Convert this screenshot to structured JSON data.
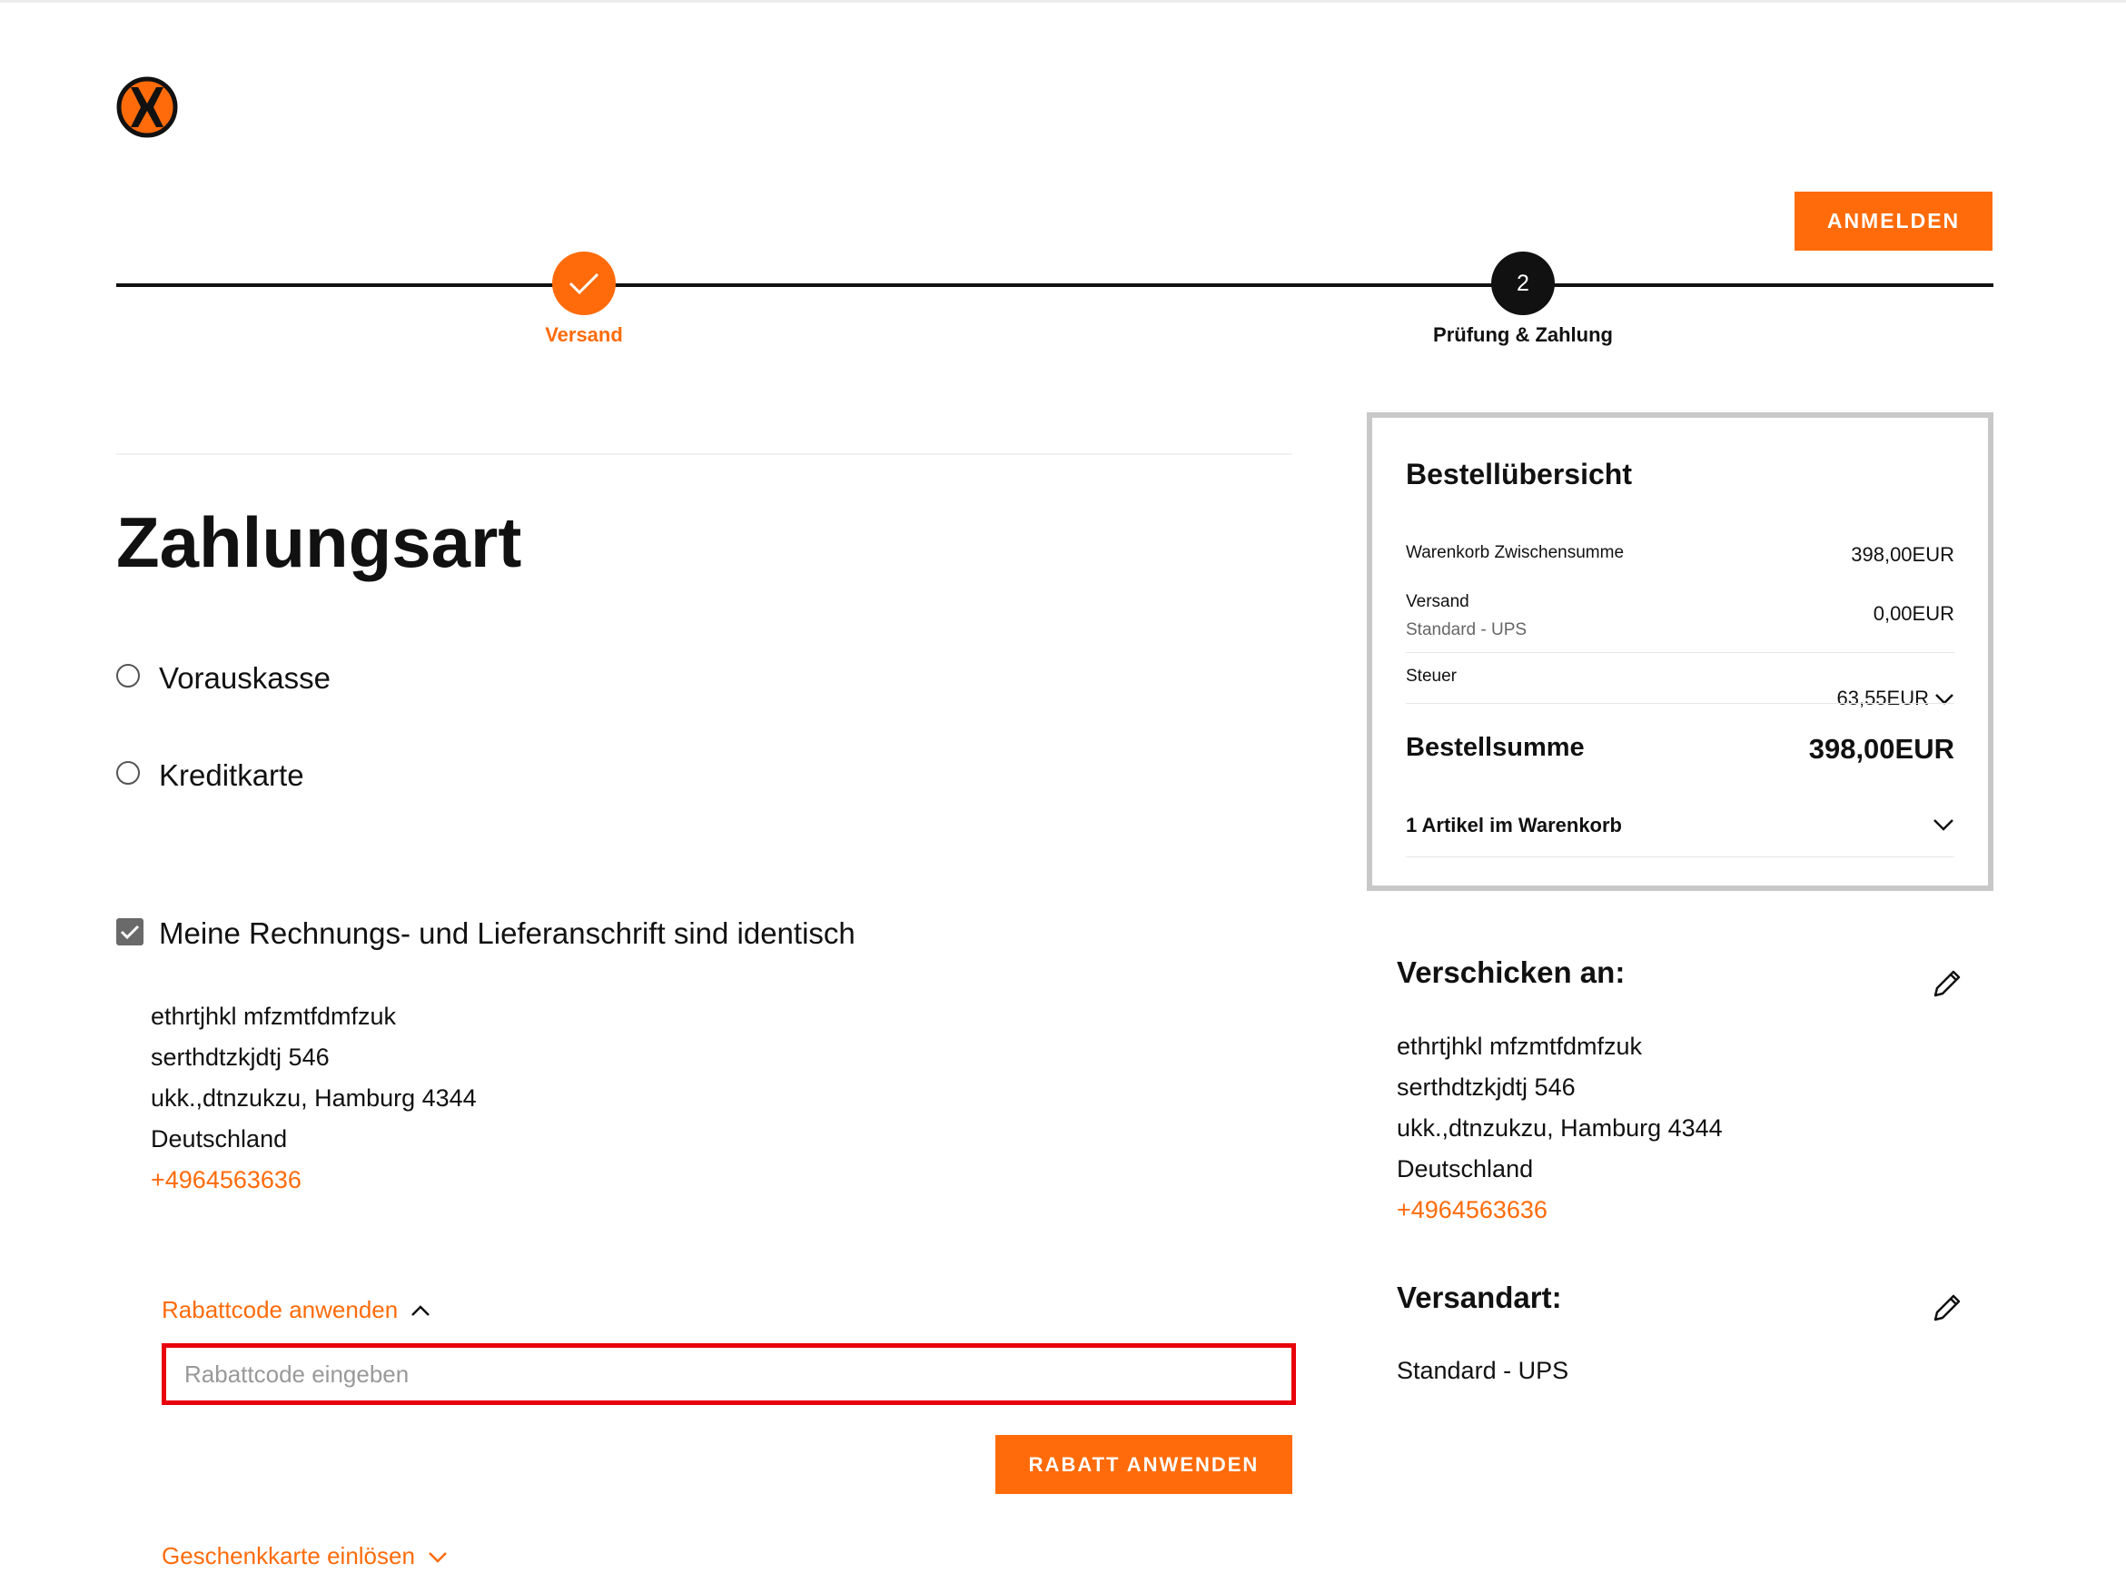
{
  "colors": {
    "accent": "#ff6b0a",
    "error_border": "#e8000b",
    "dark": "#111111"
  },
  "header": {
    "logo_icon": "brand-logo-icon",
    "signin_label": "ANMELDEN"
  },
  "steps": [
    {
      "label": "Versand",
      "state": "completed",
      "icon": "check-icon"
    },
    {
      "number": "2",
      "label": "Prüfung & Zahlung",
      "state": "current"
    }
  ],
  "payment": {
    "title": "Zahlungsart",
    "options": [
      {
        "label": "Vorauskasse",
        "selected": false
      },
      {
        "label": "Kreditkarte",
        "selected": false
      }
    ]
  },
  "billing": {
    "same_address_label": "Meine Rechnungs- und Lieferanschrift sind identisch",
    "same_address_checked": true,
    "address": {
      "name": "ethrtjhkl mfzmtfdmfzuk",
      "street": "serthdtzkjdtj 546",
      "city": "ukk.,dtnzukzu, Hamburg 4344",
      "country": "Deutschland",
      "phone": "+4964563636"
    }
  },
  "discount": {
    "toggle_label": "Rabattcode anwenden",
    "input_placeholder": "Rabattcode eingeben",
    "input_value": "",
    "apply_label": "RABATT ANWENDEN",
    "giftcard_label": "Geschenkkarte einlösen"
  },
  "summary": {
    "title": "Bestellübersicht",
    "subtotal_label": "Warenkorb Zwischensumme",
    "subtotal_value": "398,00EUR",
    "shipping_label": "Versand",
    "shipping_method": "Standard - UPS",
    "shipping_value": "0,00EUR",
    "tax_label": "Steuer",
    "tax_value": "63,55EUR",
    "total_label": "Bestellsumme",
    "total_value": "398,00EUR",
    "items_label": "1 Artikel im Warenkorb"
  },
  "ship_to": {
    "title": "Verschicken an:",
    "name": "ethrtjhkl mfzmtfdmfzuk",
    "street": "serthdtzkjdtj 546",
    "city": "ukk.,dtnzukzu, Hamburg 4344",
    "country": "Deutschland",
    "phone": "+4964563636"
  },
  "shipping_method": {
    "title": "Versandart:",
    "value": "Standard - UPS"
  }
}
